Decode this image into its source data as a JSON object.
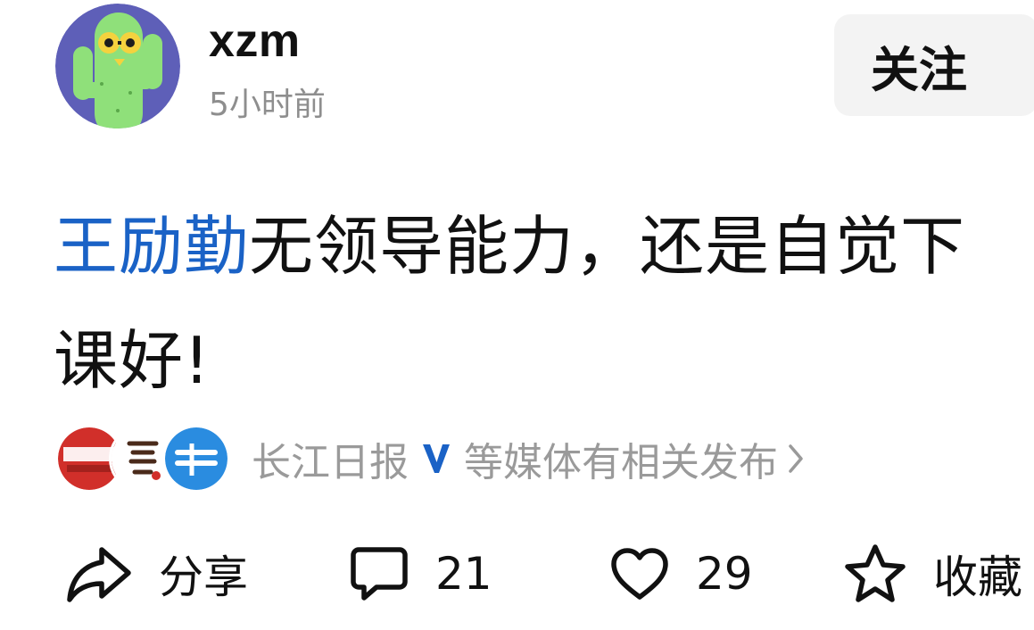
{
  "header": {
    "username": "xzm",
    "timestamp": "5小时前",
    "follow_label": "关注"
  },
  "post": {
    "mention": "王励勤",
    "text_rest": "无领导能力，还是自觉下课好!"
  },
  "sources": {
    "label": "长江日报",
    "suffix": "等媒体有相关发布",
    "verified_color": "#1a62c6"
  },
  "actions": {
    "share_label": "分享",
    "comments_count": "21",
    "likes_count": "29",
    "favorite_label": "收藏"
  },
  "colors": {
    "mention": "#1a62c6",
    "muted_text": "#8e8e8e",
    "follow_bg": "#f3f3f3"
  },
  "icons": {
    "avatar": "cactus-avatar",
    "share": "share-arrow-icon",
    "comment": "comment-bubble-icon",
    "like": "heart-icon",
    "favorite": "star-icon"
  }
}
